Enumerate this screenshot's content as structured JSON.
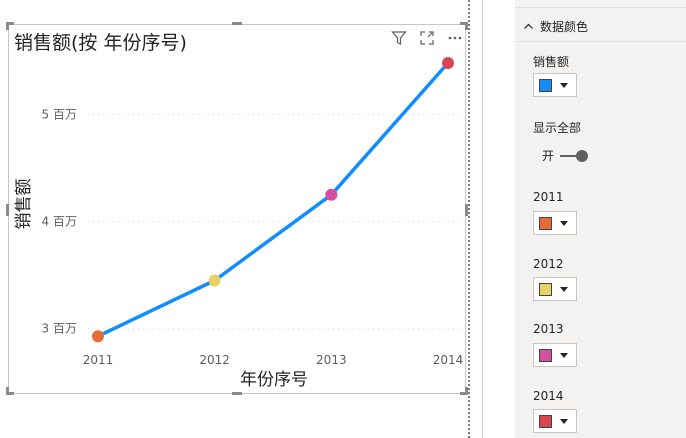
{
  "visual": {
    "title": "销售额(按 年份序号)",
    "icons": [
      "filter-icon",
      "focus-mode-icon",
      "more-options-icon"
    ]
  },
  "chart_data": {
    "type": "line",
    "title": "销售额(按 年份序号)",
    "xlabel": "年份序号",
    "ylabel": "销售额",
    "categories": [
      "2011",
      "2012",
      "2013",
      "2014"
    ],
    "series": [
      {
        "name": "销售额",
        "values": [
          2930000,
          3450000,
          4250000,
          5480000
        ],
        "color": "#118dff"
      }
    ],
    "point_colors": [
      "#e66c37",
      "#e8d166",
      "#d64fa4",
      "#d64550"
    ],
    "y_ticks": [
      {
        "value": 3000000,
        "label": "3 百万"
      },
      {
        "value": 4000000,
        "label": "4 百万"
      },
      {
        "value": 5000000,
        "label": "5 百万"
      }
    ],
    "ylim": [
      2400000,
      5480000
    ],
    "grid": true,
    "legend": "none"
  },
  "format_pane": {
    "section_title": "数据颜色",
    "default_color_label": "销售额",
    "default_color": "#118dff",
    "show_all_label": "显示全部",
    "toggle_state": "开",
    "items": [
      {
        "label": "2011",
        "color": "#e66c37"
      },
      {
        "label": "2012",
        "color": "#e8d166"
      },
      {
        "label": "2013",
        "color": "#d64fa4"
      },
      {
        "label": "2014",
        "color": "#d64550"
      }
    ]
  }
}
